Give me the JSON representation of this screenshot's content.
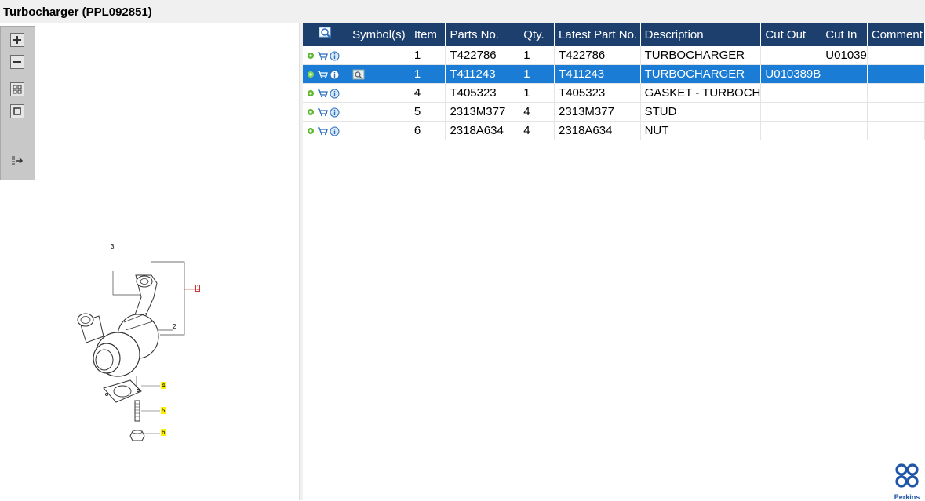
{
  "window": {
    "title": "Turbocharger (PPL092851)"
  },
  "toolbar": {
    "buttons": [
      {
        "name": "zoom-in",
        "icon": "plus-icon"
      },
      {
        "name": "zoom-out",
        "icon": "minus-icon"
      },
      {
        "name": "fit-all",
        "icon": "grid-icon"
      },
      {
        "name": "fit-window",
        "icon": "square-icon"
      },
      {
        "name": "export",
        "icon": "export-icon"
      }
    ]
  },
  "drawing": {
    "callouts": [
      "3",
      "1",
      "2",
      "4",
      "5",
      "6"
    ]
  },
  "grid": {
    "columns": [
      "",
      "Symbol(s)",
      "Item",
      "Parts No.",
      "Qty.",
      "Latest Part No.",
      "Description",
      "Cut Out",
      "Cut In",
      "Comment"
    ],
    "rows": [
      {
        "item": "1",
        "parts_no": "T422786",
        "qty": "1",
        "latest": "T422786",
        "description": "TURBOCHARGER",
        "cut_out": "",
        "cut_in": "U01039",
        "comment": "",
        "selected": false,
        "has_symbol": false
      },
      {
        "item": "1",
        "parts_no": "T411243",
        "qty": "1",
        "latest": "T411243",
        "description": "TURBOCHARGER",
        "cut_out": "U010389B",
        "cut_in": "",
        "comment": "",
        "selected": true,
        "has_symbol": true
      },
      {
        "item": "4",
        "parts_no": "T405323",
        "qty": "1",
        "latest": "T405323",
        "description": "GASKET - TURBOCH",
        "cut_out": "",
        "cut_in": "",
        "comment": "",
        "selected": false,
        "has_symbol": false
      },
      {
        "item": "5",
        "parts_no": "2313M377",
        "qty": "4",
        "latest": "2313M377",
        "description": "STUD",
        "cut_out": "",
        "cut_in": "",
        "comment": "",
        "selected": false,
        "has_symbol": false
      },
      {
        "item": "6",
        "parts_no": "2318A634",
        "qty": "4",
        "latest": "2318A634",
        "description": "NUT",
        "cut_out": "",
        "cut_in": "",
        "comment": "",
        "selected": false,
        "has_symbol": false
      }
    ]
  },
  "brand": {
    "name": "Perkins",
    "color": "#1f56a8"
  },
  "colors": {
    "header_bg": "#1c3f6e",
    "selected_bg": "#1a7cd5",
    "callout_highlight": "#ffef00"
  }
}
